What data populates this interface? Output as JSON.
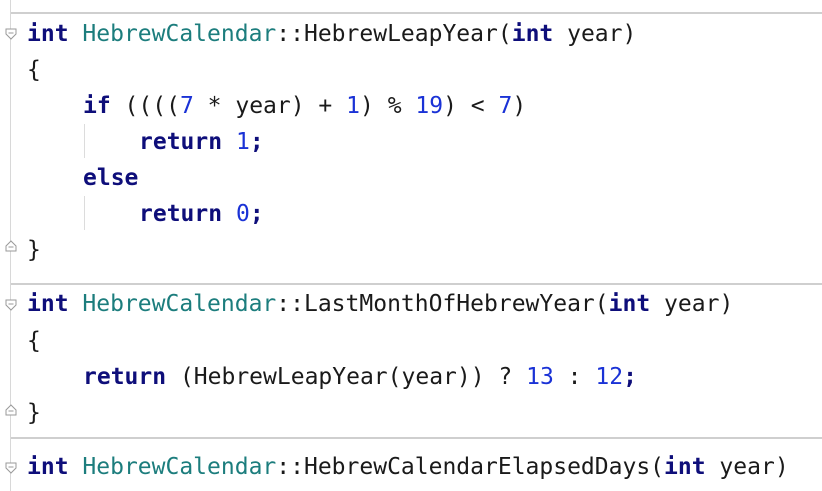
{
  "editor": {
    "blocks": [
      {
        "signature": {
          "type_kw": "int",
          "class_name": "HebrewCalendar",
          "scope": "::",
          "method": "HebrewLeapYear",
          "open_paren": "(",
          "param_kw": "int",
          "param_name": " year",
          "close_paren": ")"
        },
        "open_brace": "{",
        "if_kw": "if",
        "if_expr_a": " ((((",
        "if_n7a": "7",
        "if_expr_b": " * year) + ",
        "if_n1": "1",
        "if_expr_c": ") % ",
        "if_n19": "19",
        "if_expr_d": ") < ",
        "if_n7b": "7",
        "if_expr_e": ")",
        "return_kw": "return",
        "ret1_val": "1",
        "semi": ";",
        "else_kw": "else",
        "ret0_val": "0",
        "close_brace": "}"
      },
      {
        "signature": {
          "type_kw": "int",
          "class_name": "HebrewCalendar",
          "scope": "::",
          "method": "LastMonthOfHebrewYear",
          "open_paren": "(",
          "param_kw": "int",
          "param_name": " year",
          "close_paren": ")"
        },
        "open_brace": "{",
        "return_kw": "return",
        "ret_expr_a": " (HebrewLeapYear(year)) ? ",
        "ret_n13": "13",
        "ret_colon": " : ",
        "ret_n12": "12",
        "semi": ";",
        "close_brace": "}"
      },
      {
        "signature": {
          "type_kw": "int",
          "class_name": "HebrewCalendar",
          "scope": "::",
          "method": "HebrewCalendarElapsedDays",
          "open_paren": "(",
          "param_kw": "int",
          "param_name": " year",
          "close_paren": ")"
        }
      }
    ]
  }
}
